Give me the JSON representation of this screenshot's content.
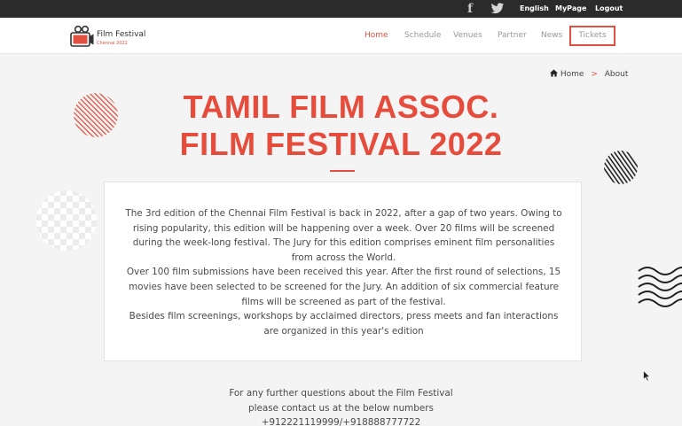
{
  "topbar": {
    "facebook_icon": "facebook-icon",
    "twitter_icon": "twitter-icon",
    "language": "English",
    "mypage": "MyPage",
    "logout": "Logout"
  },
  "brand": {
    "name": "Film Festival",
    "sub": "Chennai 2022",
    "accent": "#e15040"
  },
  "nav": {
    "home": "Home",
    "schedule": "Schedule",
    "venues": "Venues",
    "partner": "Partner",
    "news": "News",
    "tickets": "Tickets"
  },
  "breadcrumb": {
    "home": "Home",
    "separator": ">",
    "current": "About"
  },
  "title": {
    "line1": "TAMIL FILM ASSOC.",
    "line2": "FILM FESTIVAL 2022"
  },
  "about": {
    "p1": "The 3rd edition of the Chennai Film Festival is back in 2022, after a gap of two years. Owing to rising popularity, this edition will be happening over a week. Over 20 films will be screened during the week-long festival. The Jury for this edition comprises eminent film personalities from across the World.",
    "p2": "Over 100 film submissions have been received this year. After the first round of selections, 15 movies have been selected to be screened for the Jury. An addition of six commercial feature films will be screened as part of the festival.",
    "p3": "Besides film screenings, workshops by acclaimed directors, press meets and fan interactions are organized in this year's edition"
  },
  "contact": {
    "line1": "For any further questions about the Film Festival",
    "line2": "please contact us at the below numbers",
    "line3": "+912221119999/+918888777722"
  }
}
